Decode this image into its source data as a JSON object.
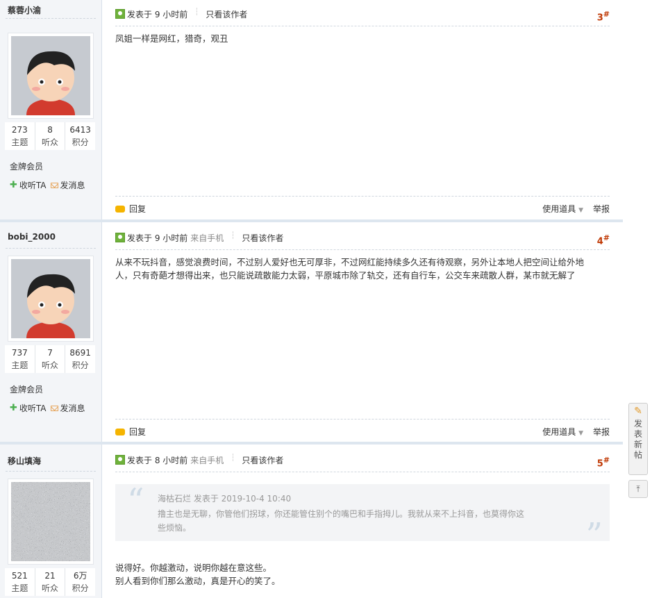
{
  "posts": [
    {
      "username": "蔡蓉小渝",
      "stats": [
        {
          "value": "273",
          "label": "主题"
        },
        {
          "value": "8",
          "label": "听众"
        },
        {
          "value": "6413",
          "label": "积分"
        }
      ],
      "rank": "金牌会员",
      "follow_label": "收听TA",
      "message_label": "发消息",
      "posted": "发表于",
      "time": "9 小时前",
      "source": "",
      "only_author": "只看该作者",
      "floor": "3",
      "floor_mark": "#",
      "content": [
        "凤姐一样是网红，猎奇，观丑"
      ],
      "reply_label": "回复",
      "tools_label": "使用道具",
      "report_label": "举报"
    },
    {
      "username": "bobi_2000",
      "stats": [
        {
          "value": "737",
          "label": "主题"
        },
        {
          "value": "7",
          "label": "听众"
        },
        {
          "value": "8691",
          "label": "积分"
        }
      ],
      "rank": "金牌会员",
      "follow_label": "收听TA",
      "message_label": "发消息",
      "posted": "发表于",
      "time": "9 小时前",
      "source": "来自手机",
      "only_author": "只看该作者",
      "floor": "4",
      "floor_mark": "#",
      "content": [
        "从来不玩抖音，感觉浪费时间，不过别人爱好也无可厚非，不过网红能持续多久还有待观察，另外让本地人把空间让给外地",
        "人，只有奇葩才想得出来，也只能说疏散能力太弱，平原城市除了轨交，还有自行车，公交车来疏散人群，某市就无解了"
      ],
      "reply_label": "回复",
      "tools_label": "使用道具",
      "report_label": "举报"
    },
    {
      "username": "移山填海",
      "stats": [
        {
          "value": "521",
          "label": "主题"
        },
        {
          "value": "21",
          "label": "听众"
        },
        {
          "value": "6万",
          "label": "积分"
        }
      ],
      "posted": "发表于",
      "time": "8 小时前",
      "source": "来自手机",
      "only_author": "只看该作者",
      "floor": "5",
      "floor_mark": "#",
      "quote": {
        "header": "海枯石烂 发表于 2019-10-4 10:40",
        "body": [
          "撸主也是无聊，你管他们拐球，你还能管住别个的嘴巴和手指拇儿。我就从来不上抖音，也莫得你这",
          "些烦恼。"
        ]
      },
      "content": [
        "说得好。你越激动，说明你越在意这些。",
        "别人看到你们那么激动，真是开心的笑了。"
      ]
    }
  ],
  "floating": {
    "new_post": "发表新帖",
    "to_top_icon": "arrow-up-icon"
  },
  "colors": {
    "floor": "#c03a06",
    "sidebar": "#f3f5f8",
    "separator": "#dde6ef"
  }
}
